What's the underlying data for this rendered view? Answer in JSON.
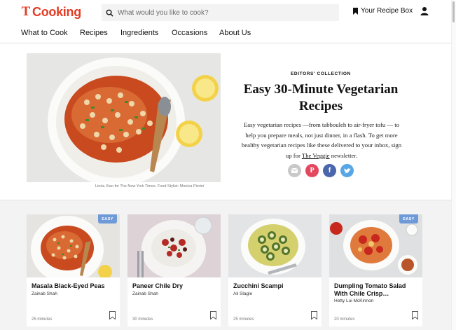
{
  "header": {
    "logo_mark": "T",
    "logo_word": "Cooking",
    "search_placeholder": "What would you like to cook?",
    "recipe_box_label": "Your Recipe Box"
  },
  "nav": {
    "items": [
      "What to Cook",
      "Recipes",
      "Ingredients",
      "Occasions",
      "About Us"
    ]
  },
  "hero": {
    "kicker": "EDITORS' COLLECTION",
    "title": "Easy 30-Minute Vegetarian Recipes",
    "description_start": "Easy vegetarian recipes —from tabbouleh to air-fryer tofu — to help you prepare meals, not just dinner, in a flash. To get more healthy vegetarian recipes like these delivered to your inbox, sign up for ",
    "description_link": "The Veggie",
    "description_end": " newsletter.",
    "credit": "Linda Xiao for The New York Times. Food Stylist: Monica Pierini"
  },
  "share": [
    {
      "icon": "email-icon",
      "color": "#c9c9c9"
    },
    {
      "icon": "pinterest-icon",
      "color": "#e4485e"
    },
    {
      "icon": "facebook-icon",
      "color": "#4a66ad"
    },
    {
      "icon": "twitter-icon",
      "color": "#57a7e6"
    }
  ],
  "cards": [
    {
      "title": "Masala Black-Eyed Peas",
      "author": "Zainab Shah",
      "time": "25 minutes",
      "badge": "EASY"
    },
    {
      "title": "Paneer Chile Dry",
      "author": "Zainab Shah",
      "time": "30 minutes",
      "badge": ""
    },
    {
      "title": "Zucchini Scampi",
      "author": "Ali Slagle",
      "time": "25 minutes",
      "badge": ""
    },
    {
      "title": "Dumpling Tomato Salad With Chile Crisp…",
      "author": "Hetty Lui McKinnon",
      "time": "20 minutes",
      "badge": "EASY"
    }
  ],
  "colors": {
    "brand": "#e33d26",
    "badge": "#6e9ad8",
    "section_bg": "#f3f3f3"
  }
}
